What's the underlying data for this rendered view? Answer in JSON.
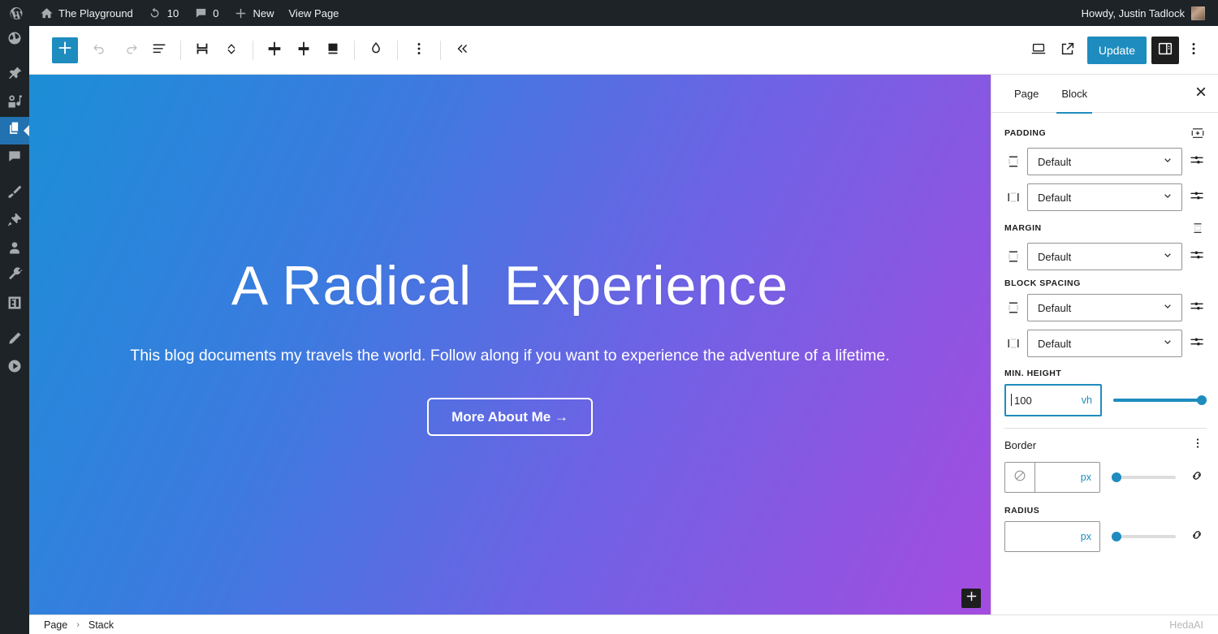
{
  "adminbar": {
    "logo_icon": "wordpress-logo-icon",
    "site_icon": "home-icon",
    "site_name": "The Playground",
    "updates_icon": "updates-icon",
    "updates_count": "10",
    "comments_icon": "comment-bubble-icon",
    "comments_count": "0",
    "new_icon": "plus-icon",
    "new_label": "New",
    "view_page_label": "View Page",
    "howdy": "Howdy, Justin Tadlock",
    "avatar_icon": "user-avatar"
  },
  "adminmenu": {
    "items": [
      {
        "name": "dashboard",
        "icon": "dashboard-icon",
        "active": false
      },
      {
        "name": "posts",
        "icon": "pin-icon",
        "active": false
      },
      {
        "name": "media",
        "icon": "media-icon",
        "active": false
      },
      {
        "name": "pages",
        "icon": "pages-icon",
        "active": true
      },
      {
        "name": "comments",
        "icon": "comment-icon",
        "active": false
      },
      {
        "name": "appearance",
        "icon": "paintbrush-icon",
        "active": false
      },
      {
        "name": "plugins",
        "icon": "plug-icon",
        "active": false
      },
      {
        "name": "users",
        "icon": "user-icon",
        "active": false
      },
      {
        "name": "tools",
        "icon": "wrench-icon",
        "active": false
      },
      {
        "name": "settings",
        "icon": "settings-icon",
        "active": false
      },
      {
        "name": "edit",
        "icon": "pencil-icon",
        "active": false
      },
      {
        "name": "play",
        "icon": "play-icon",
        "active": false
      }
    ]
  },
  "toolbar": {
    "add_block_label": "Add block",
    "add_block_icon": "plus-icon",
    "undo_icon": "undo-icon",
    "redo_icon": "redo-icon",
    "list_view_icon": "list-view-icon",
    "block_type_icon": "stack-block-icon",
    "movers_icon": "move-up-down-icon",
    "align_center_icon": "justify-center-icon",
    "align_vertical_icon": "align-vertical-icon",
    "align_bottom_icon": "align-bottom-icon",
    "color_icon": "droplet-icon",
    "options_icon": "more-vertical-icon",
    "collapse_icon": "double-chevron-left-icon",
    "preview_icon": "desktop-preview-icon",
    "view_site_icon": "external-link-icon",
    "update_label": "Update",
    "settings_panel_icon": "sidebar-panel-icon",
    "more_icon": "more-vertical-icon"
  },
  "canvas": {
    "heading": "A Radical  Experience",
    "paragraph": "This blog documents my travels the world. Follow along if you want to experience the adventure of a lifetime.",
    "button_label": "More About Me  →",
    "appender_icon": "plus-icon",
    "gradient_start": "#1b8ed6",
    "gradient_end": "#a44ce0"
  },
  "footer": {
    "breadcrumb": [
      "Page",
      "Stack"
    ],
    "separator": "›",
    "watermark": "HedaAI"
  },
  "sidebar": {
    "tabs": [
      {
        "label": "Page",
        "active": false
      },
      {
        "label": "Block",
        "active": true
      }
    ],
    "close_icon": "close-icon",
    "accent": "#1e8cbe",
    "groups": [
      {
        "label": "PADDING",
        "header_icon": "sides-horizontal-icon",
        "rows": [
          {
            "side_icon": "side-vertical-icon",
            "value": "Default",
            "chevron_icon": "chevron-down-icon",
            "tool_icon": "sliders-icon"
          },
          {
            "side_icon": "side-horizontal-icon",
            "value": "Default",
            "chevron_icon": "chevron-down-icon",
            "tool_icon": "sliders-icon"
          }
        ]
      },
      {
        "label": "MARGIN",
        "header_icon": "sides-vertical-icon",
        "rows": [
          {
            "side_icon": "side-vertical-icon",
            "value": "Default",
            "chevron_icon": "chevron-down-icon",
            "tool_icon": "sliders-icon"
          }
        ]
      },
      {
        "label": "BLOCK SPACING",
        "header_icon": "",
        "rows": [
          {
            "side_icon": "side-vertical-icon",
            "value": "Default",
            "chevron_icon": "chevron-down-icon",
            "tool_icon": "sliders-icon"
          },
          {
            "side_icon": "side-horizontal-icon",
            "value": "Default",
            "chevron_icon": "chevron-down-icon",
            "tool_icon": "sliders-icon"
          }
        ]
      }
    ],
    "min_height": {
      "label": "MIN. HEIGHT",
      "value": "100",
      "unit": "vh",
      "slider_percent": 100
    },
    "border_panel": {
      "title": "Border",
      "options_icon": "more-vertical-icon",
      "swatch_icon": "no-color-icon",
      "unit": "px",
      "value": "",
      "slider_percent": 0,
      "link_icon": "link-icon"
    },
    "radius": {
      "label": "RADIUS",
      "unit": "px",
      "value": "",
      "slider_percent": 0,
      "link_icon": "link-icon"
    }
  }
}
